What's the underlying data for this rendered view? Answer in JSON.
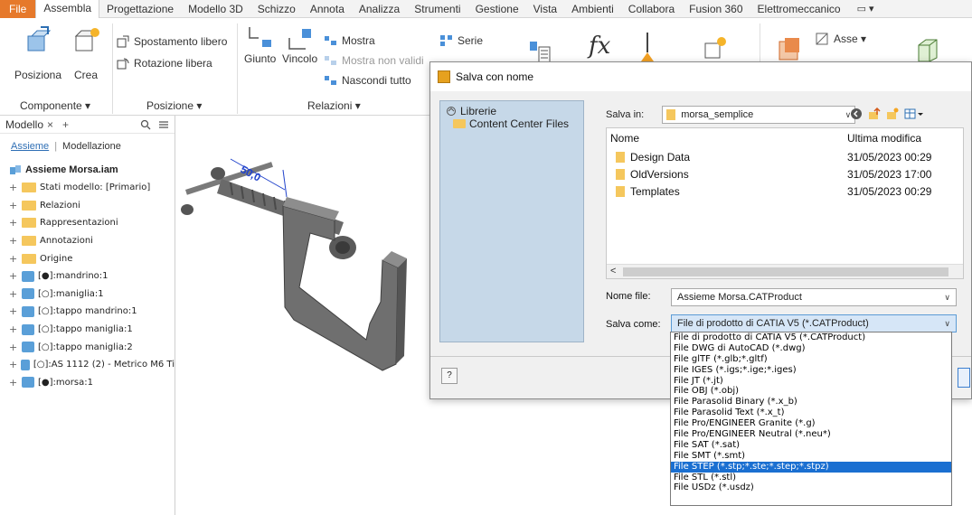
{
  "ribbon_tabs": [
    {
      "label": "File",
      "kind": "file"
    },
    {
      "label": "Assembla",
      "kind": "active"
    },
    {
      "label": "Progettazione",
      "kind": ""
    },
    {
      "label": "Modello 3D",
      "kind": ""
    },
    {
      "label": "Schizzo",
      "kind": ""
    },
    {
      "label": "Annota",
      "kind": ""
    },
    {
      "label": "Analizza",
      "kind": ""
    },
    {
      "label": "Strumenti",
      "kind": ""
    },
    {
      "label": "Gestione",
      "kind": ""
    },
    {
      "label": "Vista",
      "kind": ""
    },
    {
      "label": "Ambienti",
      "kind": ""
    },
    {
      "label": "Collabora",
      "kind": ""
    },
    {
      "label": "Fusion 360",
      "kind": ""
    },
    {
      "label": "Elettromeccanico",
      "kind": ""
    }
  ],
  "ribbon": {
    "posiziona": "Posiziona",
    "crea": "Crea",
    "componente_panel": "Componente ▾",
    "spostamento_libero": "Spostamento libero",
    "rotazione_libera": "Rotazione libera",
    "posizione_panel": "Posizione ▾",
    "giunto": "Giunto",
    "vincolo": "Vincolo",
    "mostra": "Mostra",
    "mostra_non_validi": "Mostra non validi",
    "nascondi_tutto": "Nascondi tutto",
    "relazioni_panel": "Relazioni ▾",
    "serie": "Serie",
    "fx_symbol": "fx",
    "asse": "Asse ▾"
  },
  "browser": {
    "title": "Modello",
    "close": "×",
    "plus": "+",
    "subtab_assieme": "Assieme",
    "subtab_modellazione": "Modellazione",
    "root": "Assieme Morsa.iam",
    "items": [
      {
        "label": "Stati modello: [Primario]",
        "icon": "folder"
      },
      {
        "label": "Relazioni",
        "icon": "folder"
      },
      {
        "label": "Rappresentazioni",
        "icon": "folder"
      },
      {
        "label": "Annotazioni",
        "icon": "folder"
      },
      {
        "label": "Origine",
        "icon": "folder"
      },
      {
        "label": "[●]:mandrino:1",
        "icon": "part"
      },
      {
        "label": "[○]:maniglia:1",
        "icon": "part"
      },
      {
        "label": "[○]:tappo mandrino:1",
        "icon": "part"
      },
      {
        "label": "[○]:tappo maniglia:1",
        "icon": "part"
      },
      {
        "label": "[○]:tappo maniglia:2",
        "icon": "part"
      },
      {
        "label": "[○]:AS 1112 (2) - Metrico M6  Ti",
        "icon": "part"
      },
      {
        "label": "[●]:morsa:1",
        "icon": "part"
      }
    ]
  },
  "canvas": {
    "dimension_label": "50,0"
  },
  "dialog": {
    "title": "Salva con nome",
    "libraries": "Librerie",
    "content_center": "Content Center Files",
    "save_in_label": "Salva in:",
    "save_in_value": "morsa_semplice",
    "col_name": "Nome",
    "col_modified": "Ultima modifica",
    "files": [
      {
        "name": "Design Data",
        "modified": "31/05/2023 00:29"
      },
      {
        "name": "OldVersions",
        "modified": "31/05/2023 17:00"
      },
      {
        "name": "Templates",
        "modified": "31/05/2023 00:29"
      }
    ],
    "filename_label": "Nome file:",
    "filename_value": "Assieme Morsa.CATProduct",
    "saveas_label": "Salva come:",
    "saveas_value": "File di prodotto di CATIA V5 (*.CATProduct)",
    "help": "?",
    "file_types": [
      "File di prodotto di CATIA V5 (*.CATProduct)",
      "File DWG di AutoCAD (*.dwg)",
      "File glTF (*.glb;*.gltf)",
      "File IGES (*.igs;*.ige;*.iges)",
      "File JT (*.jt)",
      "File OBJ (*.obj)",
      "File Parasolid Binary (*.x_b)",
      "File Parasolid Text (*.x_t)",
      "File Pro/ENGINEER Granite (*.g)",
      "File Pro/ENGINEER Neutral (*.neu*)",
      "File SAT (*.sat)",
      "File SMT (*.smt)",
      "File STEP (*.stp;*.ste;*.step;*.stpz)",
      "File STL (*.stl)",
      "File USDz (*.usdz)"
    ],
    "highlighted_type": "File STEP (*.stp;*.ste;*.step;*.stpz)"
  },
  "colors": {
    "file_tab": "#e6792b",
    "library_panel": "#c6d8e8",
    "highlight": "#1a6fd1",
    "model_gray": "#6f6f6f"
  }
}
